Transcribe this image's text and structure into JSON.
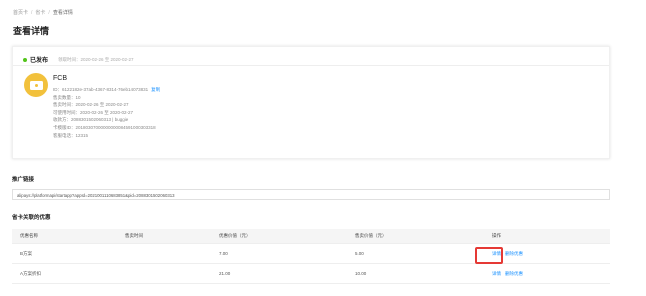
{
  "breadcrumb": {
    "items": [
      "首页卡",
      "省卡",
      "查看详情"
    ]
  },
  "page_title": "查看详情",
  "status": {
    "label": "已发布",
    "time": "领取时间：2020-02-26 至 2020-02-27",
    "color": "#52c41a"
  },
  "coupon": {
    "icon": "coupon-card-icon",
    "icon_color": "#f2c13c",
    "name": "FCB",
    "id_line": "ID：6122182e-37ab-4367-8314-76eb14073831",
    "copy_label": "复制",
    "lines": [
      "售卖数量：10",
      "售卖时间：2020-02-26 至 2020-02-27",
      "可使用时间：2020-02-26 至 2020-02-27",
      "收款方：2088301502060313 | buggie",
      "卡模版ID：20180307000000000084591000303318",
      "客服电话：12315"
    ]
  },
  "promo": {
    "title": "推广链接",
    "link": "alipays://platformapi/startapp?appId=2021001110683851&pid=2088301502060313"
  },
  "benefits": {
    "title": "省卡关联的优惠",
    "columns": [
      "优惠名称",
      "售卖时间",
      "优惠价值（元）",
      "售卖价值（元）",
      "操作"
    ],
    "rows": [
      {
        "name": "B方案",
        "time": "",
        "value": "7.00",
        "price": "5.00",
        "op_detail": "详情",
        "op_remove": "删除优惠"
      },
      {
        "name": "A方案折扣",
        "time": "",
        "value": "21.00",
        "price": "10.00",
        "op_detail": "详情",
        "op_remove": "删除优惠"
      }
    ]
  },
  "colors": {
    "link": "#1890ff",
    "highlight": "#e53935"
  }
}
